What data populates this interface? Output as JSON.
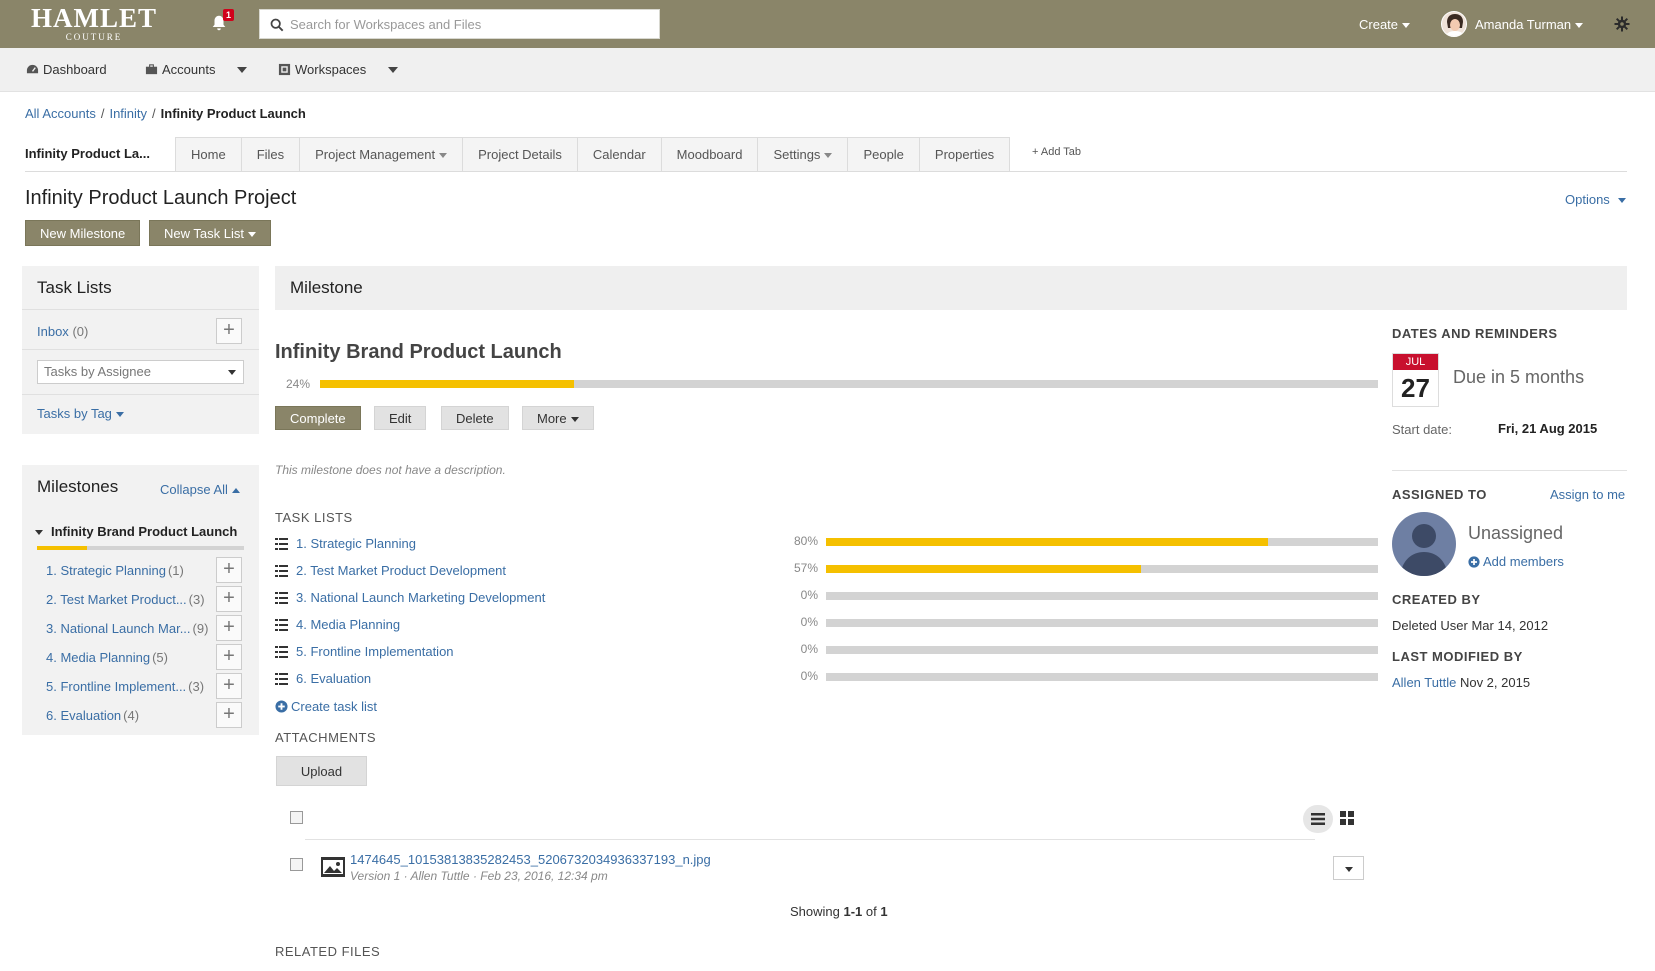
{
  "header": {
    "logo_line1": "HAMLET",
    "logo_line2": "COUTURE",
    "notification_count": "1",
    "search_placeholder": "Search for Workspaces and Files",
    "create_label": "Create",
    "user_name": "Amanda Turman"
  },
  "subnav": {
    "dashboard": "Dashboard",
    "accounts": "Accounts",
    "workspaces": "Workspaces"
  },
  "breadcrumb": {
    "all_accounts": "All Accounts",
    "account": "Infinity",
    "current": "Infinity Product Launch"
  },
  "workspace_name": "Infinity Product La...",
  "tabs": [
    "Home",
    "Files",
    "Project Management",
    "Project Details",
    "Calendar",
    "Moodboard",
    "Settings",
    "People",
    "Properties"
  ],
  "add_tab": "+ Add Tab",
  "page": {
    "title": "Infinity Product Launch Project",
    "options": "Options",
    "new_milestone": "New Milestone",
    "new_task_list": "New Task List"
  },
  "task_lists_panel": {
    "title": "Task Lists",
    "inbox_label": "Inbox",
    "inbox_count": "(0)",
    "filter_select": "Tasks by Assignee",
    "tasks_by_tag": "Tasks by Tag"
  },
  "milestones_panel": {
    "title": "Milestones",
    "collapse_all": "Collapse All",
    "current_milestone": "Infinity Brand Product Launch",
    "progress": 0.24,
    "items": [
      {
        "label": "1. Strategic Planning",
        "count": "(1)"
      },
      {
        "label": "2. Test Market Product...",
        "count": "(3)"
      },
      {
        "label": "3. National Launch Mar...",
        "count": "(9)"
      },
      {
        "label": "4. Media Planning",
        "count": "(5)"
      },
      {
        "label": "5. Frontline Implement...",
        "count": "(3)"
      },
      {
        "label": "6. Evaluation",
        "count": "(4)"
      }
    ]
  },
  "milestone": {
    "section_title": "Milestone",
    "name": "Infinity Brand Product Launch",
    "progress_label": "24%",
    "progress": 0.24,
    "buttons": {
      "complete": "Complete",
      "edit": "Edit",
      "delete": "Delete",
      "more": "More"
    },
    "description": "This milestone does not have a description.",
    "task_lists_heading": "TASK LISTS",
    "task_lists": [
      {
        "label": "1. Strategic Planning",
        "pct": "80%",
        "progress": 0.8
      },
      {
        "label": "2. Test Market Product Development",
        "pct": "57%",
        "progress": 0.57
      },
      {
        "label": "3. National Launch Marketing Development",
        "pct": "0%",
        "progress": 0
      },
      {
        "label": "4. Media Planning",
        "pct": "0%",
        "progress": 0
      },
      {
        "label": "5. Frontline Implementation",
        "pct": "0%",
        "progress": 0
      },
      {
        "label": "6. Evaluation",
        "pct": "0%",
        "progress": 0
      }
    ],
    "create_task_list": "Create task list",
    "attachments_heading": "ATTACHMENTS",
    "upload": "Upload",
    "file": {
      "name": "1474645_10153813835282453_5206732034936337193_n.jpg",
      "meta": "Version 1 · Allen Tuttle · Feb 23, 2016, 12:34 pm"
    },
    "showing_prefix": "Showing ",
    "showing_range": "1-1",
    "showing_of": " of ",
    "showing_total": "1",
    "related_files": "RELATED FILES"
  },
  "sidebar": {
    "dates_heading": "DATES AND REMINDERS",
    "cal_month": "JUL",
    "cal_day": "27",
    "due_text": "Due in 5 months",
    "start_label": "Start date:",
    "start_value": "Fri, 21 Aug 2015",
    "assigned_heading": "ASSIGNED TO",
    "assign_to_me": "Assign to me",
    "unassigned": "Unassigned",
    "add_members": "Add members",
    "created_heading": "CREATED BY",
    "created_value": "Deleted User Mar 14, 2012",
    "modified_heading": "LAST MODIFIED BY",
    "modified_user": "Allen Tuttle",
    "modified_date": "Nov 2, 2015"
  },
  "colors": {
    "header_bg": "#8a8569",
    "progress": "#f5c000",
    "link": "#3a6ea5",
    "calendar_red": "#c8102e"
  }
}
